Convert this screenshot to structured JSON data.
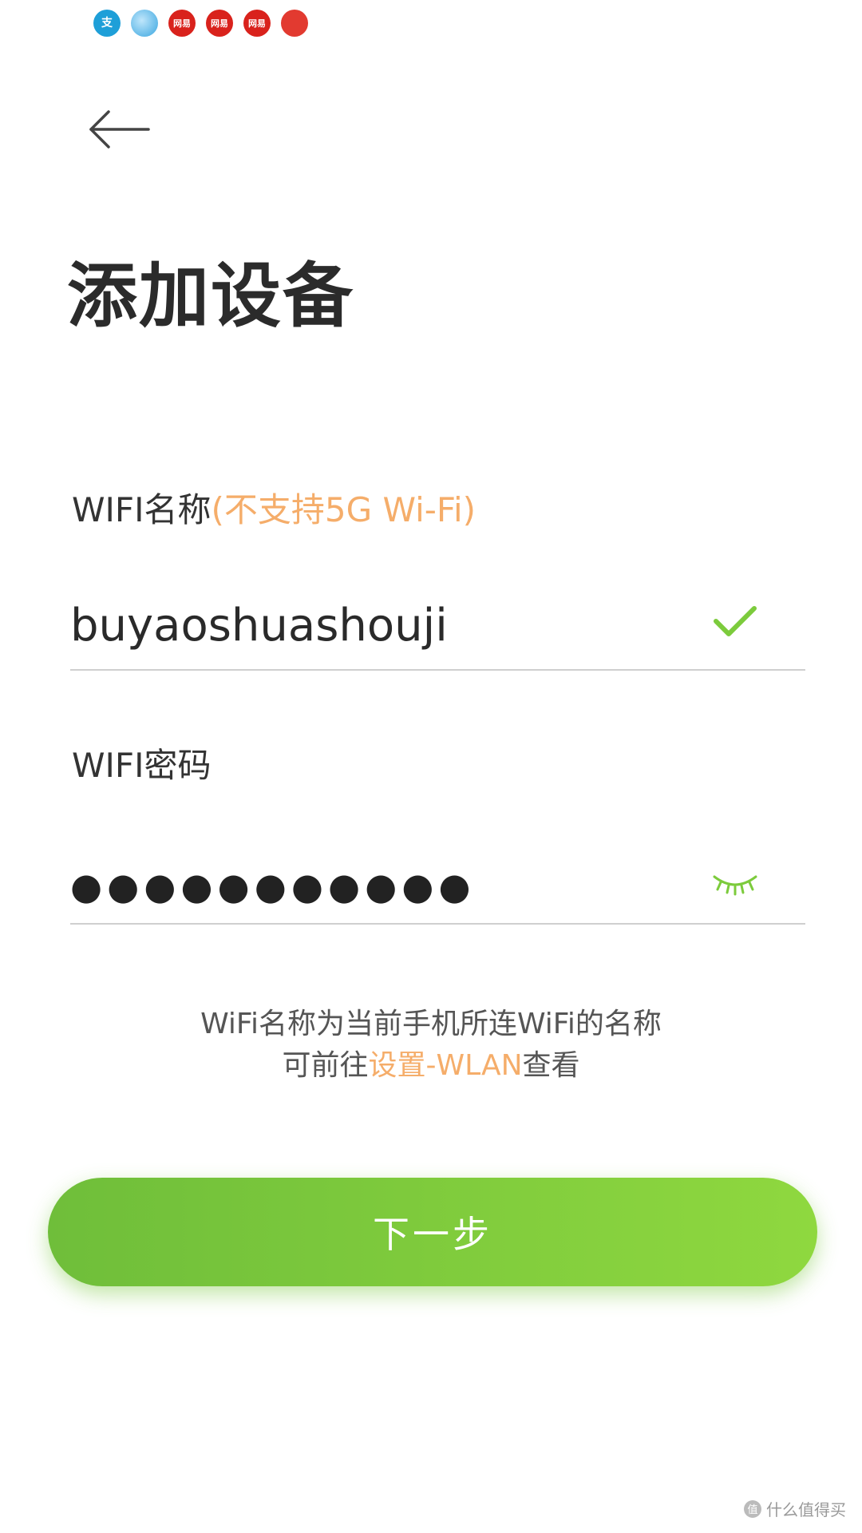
{
  "status_bar": {
    "icons": [
      {
        "name": "alipay-icon",
        "glyph": "支"
      },
      {
        "name": "browser-icon",
        "glyph": ""
      },
      {
        "name": "netease-icon",
        "glyph": "网易"
      },
      {
        "name": "netease-icon",
        "glyph": "网易"
      },
      {
        "name": "netease-icon",
        "glyph": "网易"
      },
      {
        "name": "red-app-icon",
        "glyph": ""
      }
    ]
  },
  "header": {
    "back_icon": "arrow-left-icon",
    "title": "添加设备"
  },
  "wifi_name": {
    "label": "WIFI名称",
    "hint": "(不支持5G Wi-Fi)",
    "value": "buyaoshuashouji",
    "status_icon": "check-icon"
  },
  "wifi_password": {
    "label": "WIFI密码",
    "value": "●●●●●●●●●●●",
    "visibility_icon": "eye-closed-icon"
  },
  "tip": {
    "line1": "WiFi名称为当前手机所连WiFi的名称",
    "line2_prefix": "可前往",
    "line2_link": "设置-WLAN",
    "line2_suffix": "查看"
  },
  "next_button": {
    "label": "下一步"
  },
  "watermark": {
    "icon_glyph": "值",
    "text": "什么值得买"
  },
  "colors": {
    "accent_green": "#7ccb3c",
    "hint_orange": "#f5ad6a"
  }
}
